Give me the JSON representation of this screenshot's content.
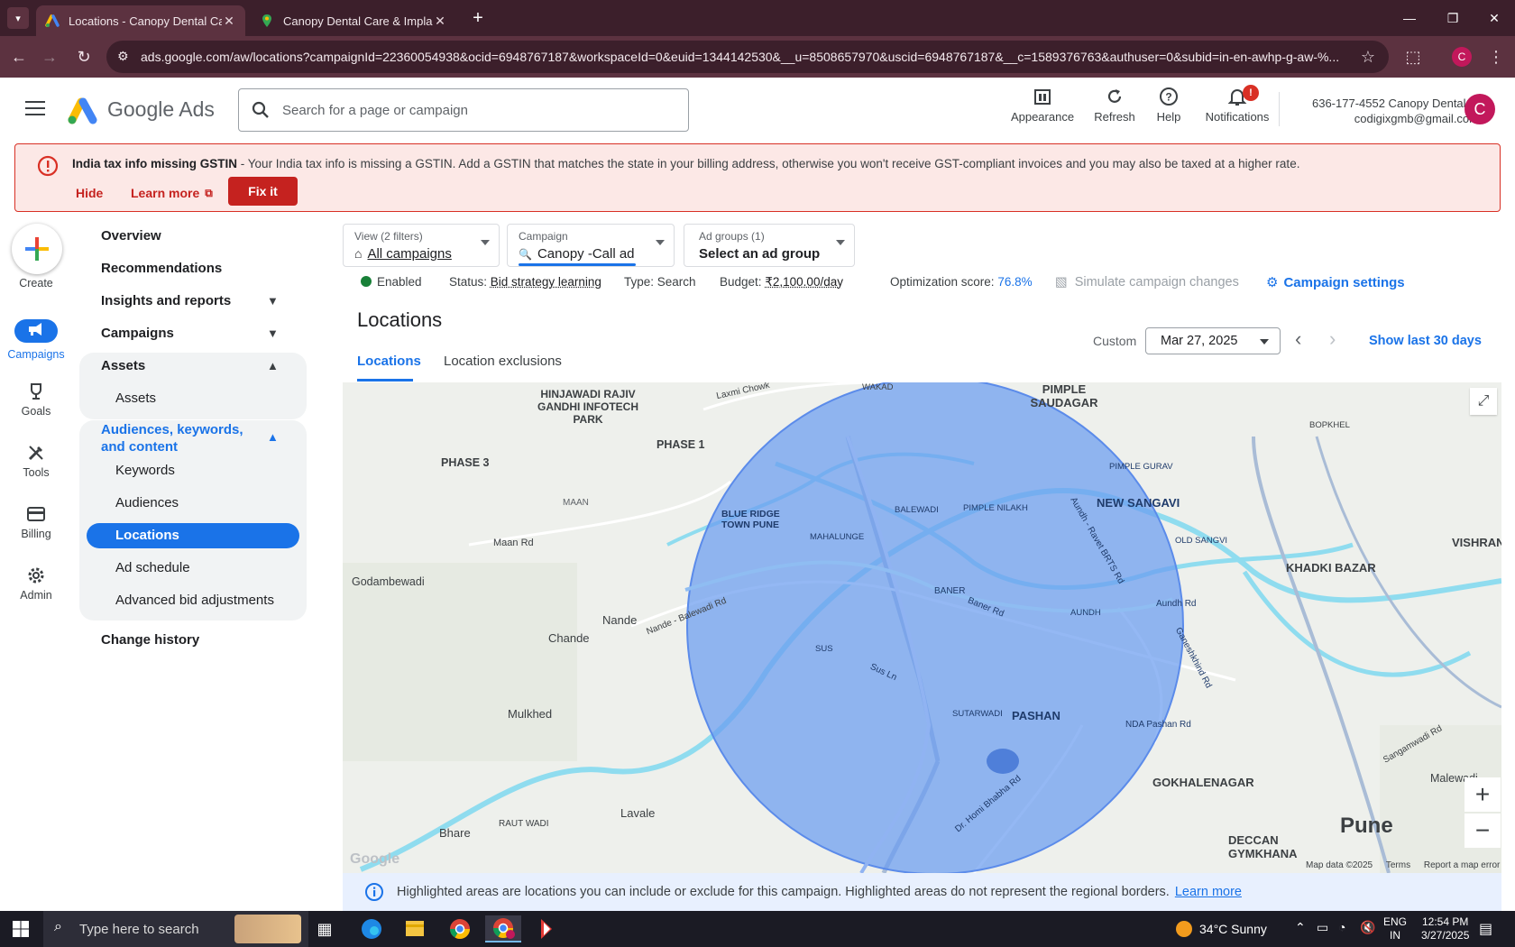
{
  "browser": {
    "tabs": [
      {
        "title": "Locations - Canopy Dental Care",
        "active": true
      },
      {
        "title": "Canopy Dental Care & Implant",
        "active": false
      }
    ],
    "url": "ads.google.com/aw/locations?campaignId=22360054938&ocid=6948767187&workspaceId=0&euid=1344142530&__u=8508657970&uscid=6948767187&__c=1589376763&authuser=0&subid=in-en-awhp-g-aw-%..."
  },
  "header": {
    "product_name": "Google Ads",
    "search_placeholder": "Search for a page or campaign",
    "appearance": "Appearance",
    "refresh": "Refresh",
    "help": "Help",
    "notifications": "Notifications",
    "notification_badge": "!",
    "account_name": "636-177-4552 Canopy Dental ...",
    "account_email": "codigixgmb@gmail.com",
    "avatar_letter": "C"
  },
  "banner": {
    "title": "India tax info missing GSTIN",
    "message": " - Your India tax info is missing a GSTIN. Add a GSTIN that matches the state in your billing address, otherwise you won't receive GST-compliant invoices and you may also be taxed at a higher rate.",
    "hide": "Hide",
    "learn_more": "Learn more",
    "fix_it": "Fix it"
  },
  "rail": {
    "create": "Create",
    "campaigns": "Campaigns",
    "goals": "Goals",
    "tools": "Tools",
    "billing": "Billing",
    "admin": "Admin"
  },
  "nav": {
    "overview": "Overview",
    "recommendations": "Recommendations",
    "insights": "Insights and reports",
    "campaigns": "Campaigns",
    "assets_group": "Assets",
    "assets": "Assets",
    "audiences_group": "Audiences, keywords, and content",
    "keywords": "Keywords",
    "audiences": "Audiences",
    "locations": "Locations",
    "ad_schedule": "Ad schedule",
    "advanced_bid": "Advanced bid adjustments",
    "change_history": "Change history"
  },
  "filters": {
    "view_label": "View (2 filters)",
    "view_value": "All campaigns",
    "campaign_label": "Campaign",
    "campaign_value": "Canopy -Call ad",
    "adgroups_label": "Ad groups (1)",
    "adgroups_value": "Select an ad group"
  },
  "status": {
    "enabled": "Enabled",
    "status_label": "Status:",
    "status_value": "Bid strategy learning",
    "type": "Type: Search",
    "budget_label": "Budget:",
    "budget_value": "₹2,100.00/day",
    "optimization_label": "Optimization score:",
    "optimization_value": "76.8%",
    "simulate": "Simulate campaign changes",
    "settings": "Campaign settings"
  },
  "page": {
    "title": "Locations",
    "tab_locations": "Locations",
    "tab_exclusions": "Location exclusions",
    "date_mode": "Custom",
    "date_value": "Mar 27, 2025",
    "show_last": "Show last 30 days"
  },
  "map": {
    "labels": [
      "HINJAWADI RAJIV GANDHI INFOTECH PARK",
      "PHASE 1",
      "PHASE 3",
      "MAAN",
      "Maan Rd",
      "Godambewadi",
      "Nande",
      "Chande",
      "Mulkhed",
      "Lavale",
      "Bhare",
      "RAUT WADI",
      "BLUE RIDGE TOWN PUNE",
      "MAHALUNGE",
      "BALEWADI",
      "PIMPLE NILAKH",
      "BANER",
      "Baner Rd",
      "AUNDH",
      "Aundh Rd",
      "SUS",
      "Sus Ln",
      "SUTARWADI",
      "PASHAN",
      "NDA Pashan Rd",
      "PIMPLE SAUDAGAR",
      "NEW SANGAVI",
      "KHADKI BAZAR",
      "VISHRANTWADI",
      "GOKHALENAGAR",
      "DECCAN GYMKHANA",
      "Pune",
      "Malewadi",
      "Laxmi Chowk",
      "WAKAD",
      "Nande - Balewadi Rd",
      "Ganeshkhind Rd",
      "Aundh - Ravet BRTS Rd",
      "BOPKHEL",
      "PIMPLE GURAV",
      "OLD SANGVI",
      "Dr. Homi Bhabha Rd",
      "Sangamwadi Rd"
    ],
    "footer_data": "Map data ©2025",
    "footer_terms": "Terms",
    "footer_report": "Report a map error",
    "google": "Google"
  },
  "infobar": {
    "text": "Highlighted areas are locations you can include or exclude for this campaign. Highlighted areas do not represent the regional borders.",
    "link": "Learn more"
  },
  "taskbar": {
    "search": "Type here to search",
    "weather": "34°C  Sunny",
    "lang1": "ENG",
    "lang2": "IN",
    "time": "12:54 PM",
    "date": "3/27/2025"
  }
}
